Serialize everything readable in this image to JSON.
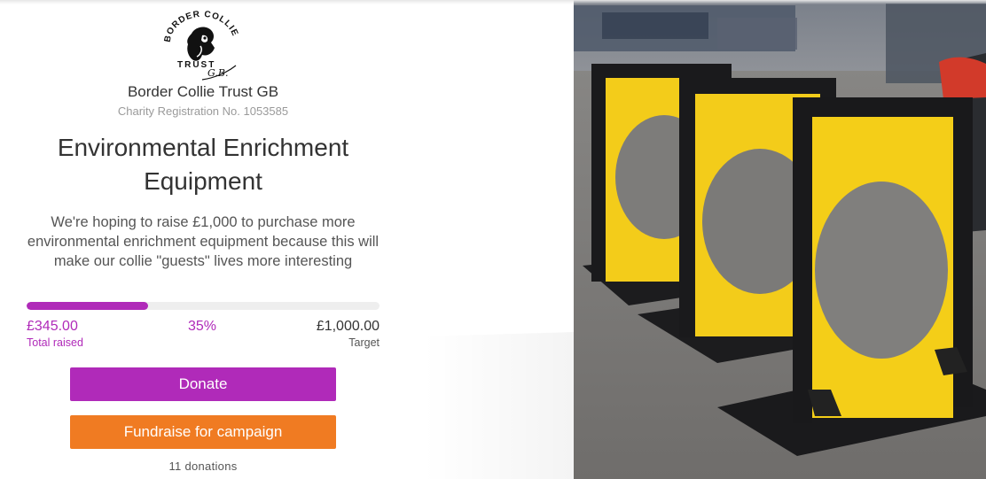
{
  "organisation": {
    "logo_text_top": "BORDER COLLIE",
    "logo_text_bottom": "TRUST",
    "logo_signature": "G.B.",
    "name": "Border Collie Trust GB",
    "registration": "Charity Registration No. 1053585"
  },
  "campaign": {
    "title": "Environmental Enrichment Equipment",
    "description": "We're hoping to raise £1,000 to purchase more environmental enrichment equipment because this will make our collie \"guests\" lives more interesting"
  },
  "progress": {
    "raised": "£345.00",
    "raised_label": "Total raised",
    "percent_text": "35%",
    "fraction": 0.345,
    "target": "£1,000.00",
    "target_label": "Target"
  },
  "actions": {
    "donate_label": "Donate",
    "fundraise_label": "Fundraise for campaign"
  },
  "stats": {
    "donations": "11 donations"
  },
  "colors": {
    "accent_purple": "#b02ab9",
    "accent_orange": "#f07b22"
  },
  "image": {
    "subject": "three yellow and black dog agility hoop jumps on tarmac",
    "icon": "campaign-photo"
  }
}
